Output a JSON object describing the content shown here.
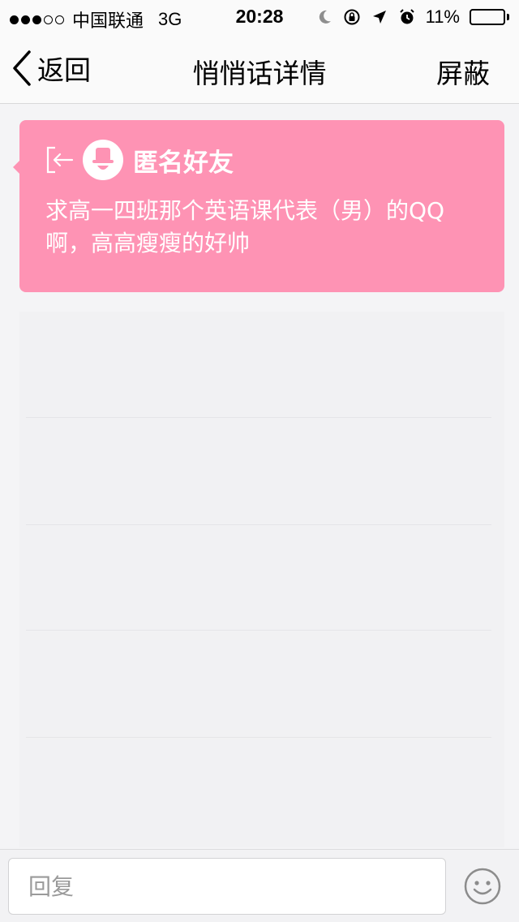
{
  "status_bar": {
    "signal_filled": 3,
    "signal_total": 5,
    "carrier": "中国联通",
    "network": "3G",
    "time": "20:28",
    "battery_percent": "11%",
    "battery_level": 0.11,
    "icons": [
      "moon-icon",
      "rotation-lock-icon",
      "location-arrow-icon",
      "alarm-icon",
      "battery-icon"
    ]
  },
  "nav": {
    "back_label": "返回",
    "title": "悄悄话详情",
    "right_action": "屏蔽"
  },
  "card": {
    "sender_name": "匿名好友",
    "message": "求高一四班那个英语课代表（男）的QQ啊，高高瘦瘦的好帅",
    "background_color": "#fe93b4"
  },
  "input": {
    "placeholder": "回复",
    "value": ""
  },
  "colors": {
    "accent": "#fe93b4",
    "battery_low": "#e8232e"
  }
}
